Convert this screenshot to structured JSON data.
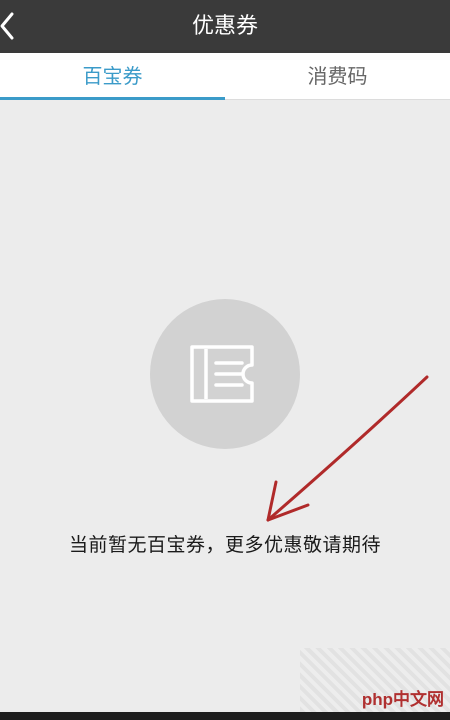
{
  "header": {
    "title": "优惠券",
    "back_icon": "chevron-left-icon"
  },
  "tabs": [
    {
      "label": "百宝券",
      "active": true
    },
    {
      "label": "消费码",
      "active": false
    }
  ],
  "empty_state": {
    "icon": "ticket-icon",
    "message": "当前暂无百宝券，更多优惠敬请期待"
  },
  "watermark": {
    "text": "php中文网"
  },
  "colors": {
    "header_bg": "#3a3a3a",
    "accent": "#3b9bc9",
    "background": "#ececec",
    "circle": "#d2d2d2",
    "arrow": "#b02a2a"
  }
}
